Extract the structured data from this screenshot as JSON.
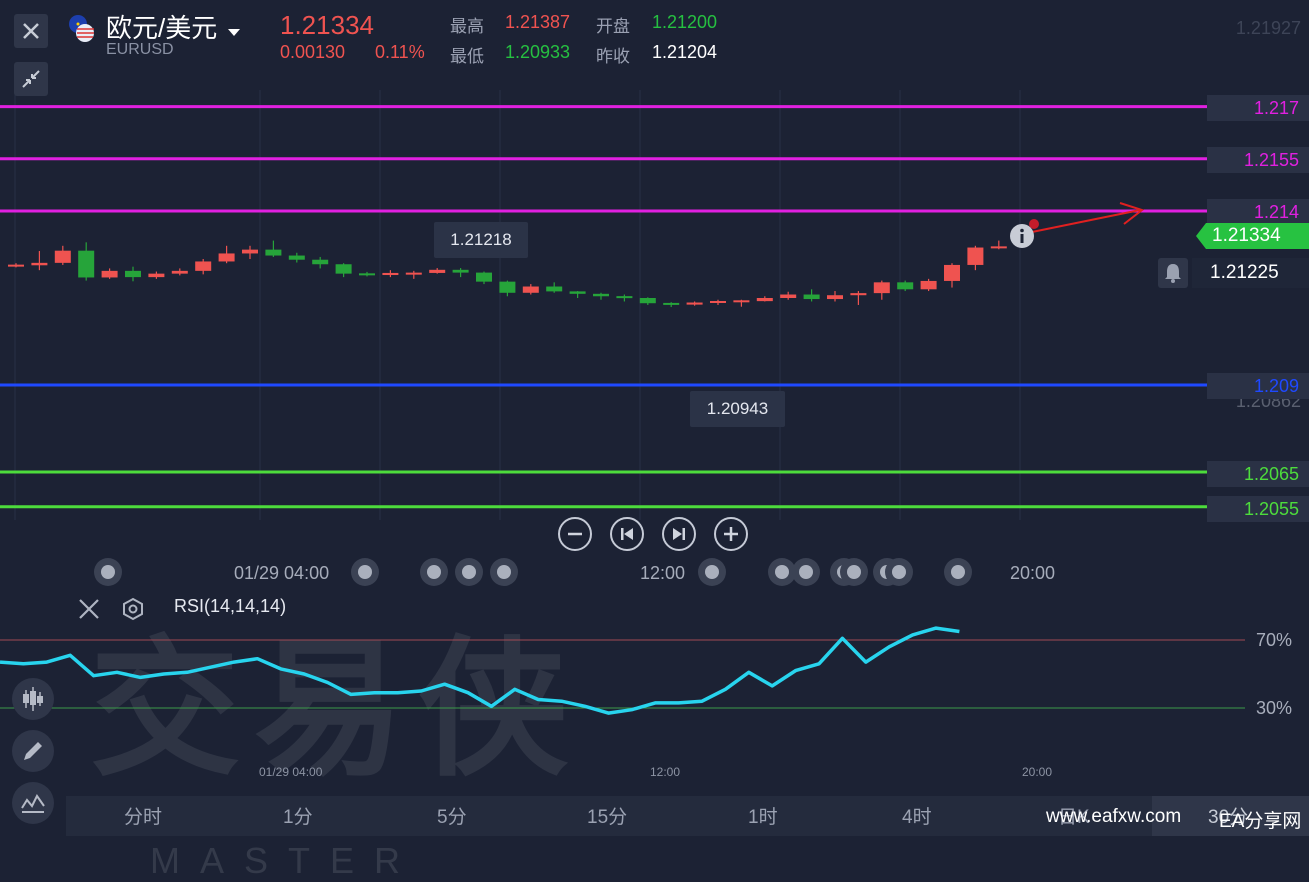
{
  "symbol": {
    "name": "欧元/美元",
    "code": "EURUSD",
    "price": "1.21334",
    "change": "0.00130",
    "change_pct": "0.11%"
  },
  "quote": {
    "high_label": "最高",
    "high": "1.21387",
    "open_label": "开盘",
    "open": "1.21200",
    "low_label": "最低",
    "low": "1.20933",
    "prev_close_label": "昨收",
    "prev_close": "1.21204"
  },
  "price_axis": {
    "top": "1.21927",
    "bottom_partial": "1.20862",
    "current": "1.21334",
    "alert": "1.21225"
  },
  "hlines": [
    {
      "label": "1.217",
      "color": "#e020e0"
    },
    {
      "label": "1.2155",
      "color": "#e020e0"
    },
    {
      "label": "1.214",
      "color": "#e020e0"
    },
    {
      "label": "1.209",
      "color": "#1f49ff"
    },
    {
      "label": "1.2065",
      "color": "#4ddc3c"
    },
    {
      "label": "1.2055",
      "color": "#4ddc3c"
    }
  ],
  "tooltips": {
    "high": "1.21218",
    "low": "1.20943"
  },
  "time_axis": [
    "01/29 04:00",
    "12:00",
    "20:00"
  ],
  "indicator": {
    "name": "RSI(14,14,14)",
    "upper": "70%",
    "lower": "30%"
  },
  "timeframes": [
    "分时",
    "1分",
    "5分",
    "15分",
    "1时",
    "4时",
    "日K",
    "30分"
  ],
  "site": {
    "url": "www.eafxw.com",
    "name": "EA分享网"
  },
  "watermark": {
    "cn": "交易侠",
    "en": "TRADER MASTER"
  },
  "colors": {
    "up": "#ef5350",
    "down": "#26a43a",
    "rsi": "#28d4ee"
  },
  "chart_data": {
    "type": "candlestick",
    "candles": [
      [
        1.21242,
        1.21244,
        1.2125,
        1.21238
      ],
      [
        1.21244,
        1.21251,
        1.21285,
        1.2123
      ],
      [
        1.21251,
        1.21286,
        1.213,
        1.21245
      ],
      [
        1.21286,
        1.21209,
        1.2131,
        1.212
      ],
      [
        1.21209,
        1.21228,
        1.21235,
        1.21205
      ],
      [
        1.21228,
        1.2121,
        1.2124,
        1.21198
      ],
      [
        1.2121,
        1.2122,
        1.21226,
        1.21205
      ],
      [
        1.2122,
        1.21228,
        1.21235,
        1.21215
      ],
      [
        1.21228,
        1.21255,
        1.21262,
        1.21218
      ],
      [
        1.21255,
        1.21278,
        1.213,
        1.2125
      ],
      [
        1.21278,
        1.21289,
        1.213,
        1.21262
      ],
      [
        1.21289,
        1.21272,
        1.21315,
        1.21268
      ],
      [
        1.21272,
        1.2126,
        1.2128,
        1.21252
      ],
      [
        1.2126,
        1.21247,
        1.21268,
        1.21235
      ],
      [
        1.21247,
        1.2122,
        1.2125,
        1.2121
      ],
      [
        1.2122,
        1.21216,
        1.21225,
        1.21212
      ],
      [
        1.21216,
        1.21222,
        1.2123,
        1.2121
      ],
      [
        1.21218,
        1.21222,
        1.21228,
        1.21205
      ],
      [
        1.21222,
        1.21231,
        1.21236,
        1.2122
      ],
      [
        1.21231,
        1.21223,
        1.21236,
        1.2121
      ],
      [
        1.21223,
        1.21197,
        1.21226,
        1.2119
      ],
      [
        1.21197,
        1.21165,
        1.212,
        1.21155
      ],
      [
        1.21165,
        1.21183,
        1.2119,
        1.2116
      ],
      [
        1.21183,
        1.21169,
        1.21195,
        1.21165
      ],
      [
        1.21169,
        1.21162,
        1.2117,
        1.2115
      ],
      [
        1.21162,
        1.21155,
        1.21165,
        1.21145
      ],
      [
        1.21155,
        1.2115,
        1.2116,
        1.2114
      ],
      [
        1.2115,
        1.21135,
        1.21152,
        1.2113
      ],
      [
        1.21135,
        1.21131,
        1.21138,
        1.21124
      ],
      [
        1.21131,
        1.21137,
        1.2114,
        1.21128
      ],
      [
        1.21137,
        1.2114,
        1.21145,
        1.2113
      ],
      [
        1.2114,
        1.21141,
        1.21145,
        1.21125
      ],
      [
        1.21141,
        1.2115,
        1.21155,
        1.2114
      ],
      [
        1.2115,
        1.2116,
        1.21168,
        1.21145
      ],
      [
        1.2116,
        1.21147,
        1.21175,
        1.2114
      ],
      [
        1.21147,
        1.21158,
        1.2117,
        1.2114
      ],
      [
        1.21158,
        1.21164,
        1.2117,
        1.2113
      ],
      [
        1.21164,
        1.21195,
        1.212,
        1.21145
      ],
      [
        1.21195,
        1.21175,
        1.212,
        1.2117
      ],
      [
        1.21175,
        1.21199,
        1.21205,
        1.2117
      ],
      [
        1.21199,
        1.21245,
        1.2125,
        1.2118
      ],
      [
        1.21245,
        1.21295,
        1.213,
        1.2123
      ],
      [
        1.21295,
        1.21296,
        1.21315,
        1.2129
      ]
    ],
    "rsi": [
      57,
      56,
      57,
      61,
      49,
      51,
      48,
      50,
      51,
      54,
      57,
      59,
      53,
      50,
      45,
      38,
      39,
      39,
      40,
      44,
      39,
      31,
      41,
      35,
      34,
      31,
      27,
      29,
      33,
      33,
      34,
      41,
      51,
      43,
      52,
      56,
      71,
      57,
      66,
      73,
      77,
      75
    ]
  }
}
